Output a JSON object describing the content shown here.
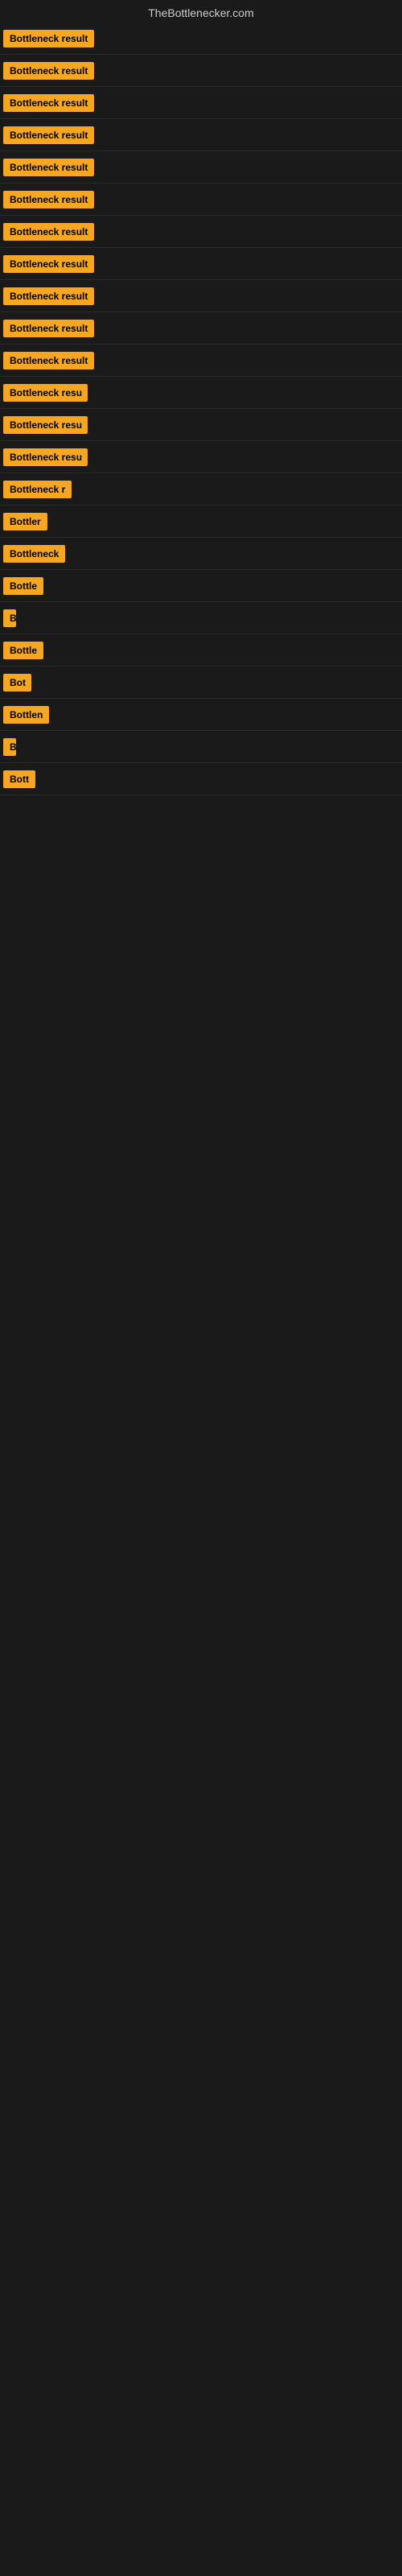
{
  "site": {
    "title": "TheBottlenecker.com"
  },
  "rows": [
    {
      "id": 1,
      "label": "Bottleneck result",
      "width": 120
    },
    {
      "id": 2,
      "label": "Bottleneck result",
      "width": 120
    },
    {
      "id": 3,
      "label": "Bottleneck result",
      "width": 120
    },
    {
      "id": 4,
      "label": "Bottleneck result",
      "width": 120
    },
    {
      "id": 5,
      "label": "Bottleneck result",
      "width": 120
    },
    {
      "id": 6,
      "label": "Bottleneck result",
      "width": 120
    },
    {
      "id": 7,
      "label": "Bottleneck result",
      "width": 120
    },
    {
      "id": 8,
      "label": "Bottleneck result",
      "width": 120
    },
    {
      "id": 9,
      "label": "Bottleneck result",
      "width": 120
    },
    {
      "id": 10,
      "label": "Bottleneck result",
      "width": 120
    },
    {
      "id": 11,
      "label": "Bottleneck result",
      "width": 120
    },
    {
      "id": 12,
      "label": "Bottleneck resu",
      "width": 105
    },
    {
      "id": 13,
      "label": "Bottleneck resu",
      "width": 105
    },
    {
      "id": 14,
      "label": "Bottleneck resu",
      "width": 105
    },
    {
      "id": 15,
      "label": "Bottleneck r",
      "width": 88
    },
    {
      "id": 16,
      "label": "Bottler",
      "width": 60
    },
    {
      "id": 17,
      "label": "Bottleneck",
      "width": 80
    },
    {
      "id": 18,
      "label": "Bottle",
      "width": 55
    },
    {
      "id": 19,
      "label": "B",
      "width": 16
    },
    {
      "id": 20,
      "label": "Bottle",
      "width": 55
    },
    {
      "id": 21,
      "label": "Bot",
      "width": 35
    },
    {
      "id": 22,
      "label": "Bottlen",
      "width": 65
    },
    {
      "id": 23,
      "label": "B",
      "width": 16
    },
    {
      "id": 24,
      "label": "Bott",
      "width": 42
    }
  ]
}
